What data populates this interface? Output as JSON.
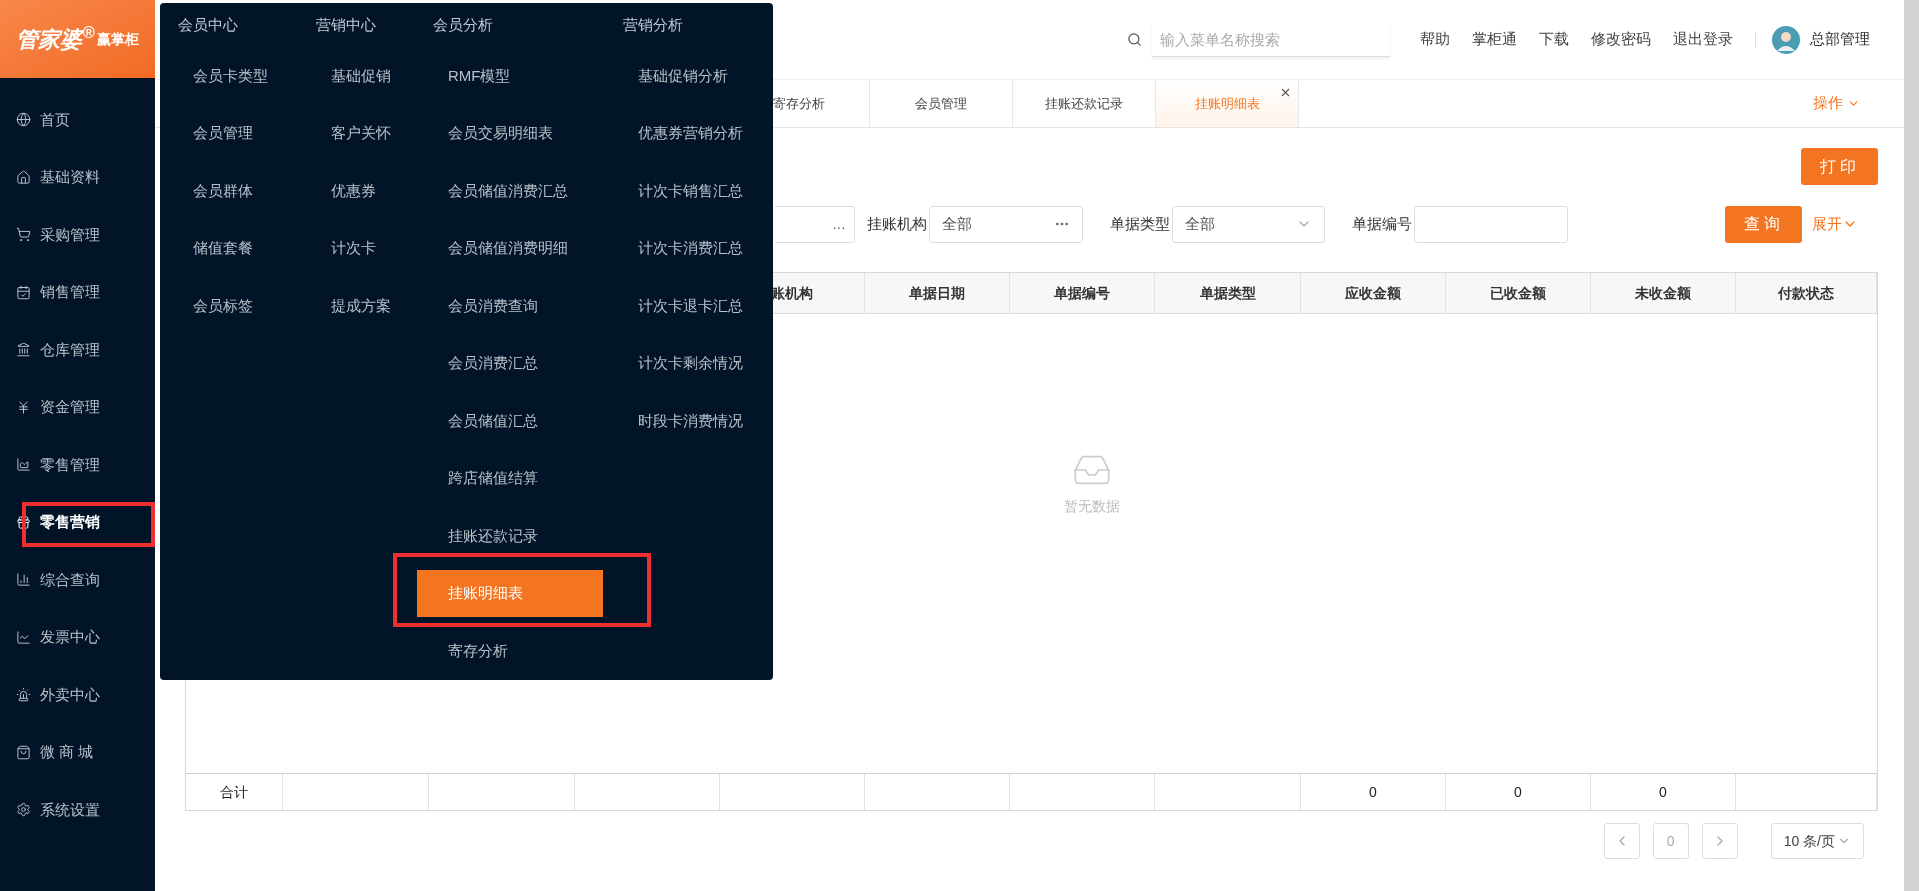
{
  "logo": {
    "title": "管家婆$^{®}$",
    "sub": "赢掌柜"
  },
  "sidebar": {
    "items": [
      {
        "label": "首页",
        "selected": false,
        "annotated": false
      },
      {
        "label": "基础资料",
        "selected": false,
        "annotated": false
      },
      {
        "label": "采购管理",
        "selected": false,
        "annotated": false
      },
      {
        "label": "销售管理",
        "selected": false,
        "annotated": false
      },
      {
        "label": "仓库管理",
        "selected": false,
        "annotated": false
      },
      {
        "label": "资金管理",
        "selected": false,
        "annotated": false
      },
      {
        "label": "零售管理",
        "selected": false,
        "annotated": false
      },
      {
        "label": "零售营销",
        "selected": true,
        "annotated": true
      },
      {
        "label": "综合查询",
        "selected": false,
        "annotated": false
      },
      {
        "label": "发票中心",
        "selected": false,
        "annotated": false
      },
      {
        "label": "外卖中心",
        "selected": false,
        "annotated": false
      },
      {
        "label": "微 商 城",
        "selected": false,
        "annotated": false
      },
      {
        "label": "系统设置",
        "selected": false,
        "annotated": false
      }
    ]
  },
  "menu": {
    "columns": [
      {
        "title": "会员中心",
        "items": [
          {
            "label": "会员卡类型",
            "selected": false,
            "annotated": false
          },
          {
            "label": "会员管理",
            "selected": false,
            "annotated": false
          },
          {
            "label": "会员群体",
            "selected": false,
            "annotated": false
          },
          {
            "label": "储值套餐",
            "selected": false,
            "annotated": false
          },
          {
            "label": "会员标签",
            "selected": false,
            "annotated": false
          }
        ]
      },
      {
        "title": "营销中心",
        "items": [
          {
            "label": "基础促销",
            "selected": false,
            "annotated": false
          },
          {
            "label": "客户关怀",
            "selected": false,
            "annotated": false
          },
          {
            "label": "优惠券",
            "selected": false,
            "annotated": false
          },
          {
            "label": "计次卡",
            "selected": false,
            "annotated": false
          },
          {
            "label": "提成方案",
            "selected": false,
            "annotated": false
          }
        ]
      },
      {
        "title": "会员分析",
        "items": [
          {
            "label": "RMF模型",
            "selected": false,
            "annotated": false
          },
          {
            "label": "会员交易明细表",
            "selected": false,
            "annotated": false
          },
          {
            "label": "会员储值消费汇总",
            "selected": false,
            "annotated": false
          },
          {
            "label": "会员储值消费明细",
            "selected": false,
            "annotated": false
          },
          {
            "label": "会员消费查询",
            "selected": false,
            "annotated": false
          },
          {
            "label": "会员消费汇总",
            "selected": false,
            "annotated": false
          },
          {
            "label": "会员储值汇总",
            "selected": false,
            "annotated": false
          },
          {
            "label": "跨店储值结算",
            "selected": false,
            "annotated": false
          },
          {
            "label": "挂账还款记录",
            "selected": false,
            "annotated": false
          },
          {
            "label": "挂账明细表",
            "selected": true,
            "annotated": true
          },
          {
            "label": "寄存分析",
            "selected": false,
            "annotated": false
          }
        ]
      },
      {
        "title": "营销分析",
        "items": [
          {
            "label": "基础促销分析",
            "selected": false,
            "annotated": false
          },
          {
            "label": "优惠券营销分析",
            "selected": false,
            "annotated": false
          },
          {
            "label": "计次卡销售汇总",
            "selected": false,
            "annotated": false
          },
          {
            "label": "计次卡消费汇总",
            "selected": false,
            "annotated": false
          },
          {
            "label": "计次卡退卡汇总",
            "selected": false,
            "annotated": false
          },
          {
            "label": "计次卡剩余情况",
            "selected": false,
            "annotated": false
          },
          {
            "label": "时段卡消费情况",
            "selected": false,
            "annotated": false
          }
        ]
      }
    ]
  },
  "header": {
    "search": {
      "placeholder": "输入菜单名称搜索"
    },
    "links": [
      "帮助",
      "掌柜通",
      "下载",
      "修改密码",
      "退出登录"
    ],
    "user": "总部管理"
  },
  "tabs": [
    {
      "label": "寄存分析",
      "selected": false,
      "closable": false
    },
    {
      "label": "会员管理",
      "selected": false,
      "closable": false
    },
    {
      "label": "挂账还款记录",
      "selected": false,
      "closable": false
    },
    {
      "label": "挂账明细表",
      "selected": true,
      "closable": true
    }
  ],
  "operations": "操作",
  "print_button": "打印",
  "filters": [
    {
      "kind": "partial",
      "value": "…"
    },
    {
      "kind": "picker",
      "label": "挂账机构",
      "value": "全部"
    },
    {
      "kind": "select",
      "label": "单据类型",
      "value": "全部"
    },
    {
      "kind": "text",
      "label": "单据编号"
    }
  ],
  "query_button": "查询",
  "expand_link": "展开",
  "table": {
    "columns": [
      "账机构",
      "单据日期",
      "单据编号",
      "单据类型",
      "应收金额",
      "已收金额",
      "未收金额",
      "付款状态"
    ],
    "empty_text": "暂无数据",
    "totals": {
      "label": "合计",
      "amounts": [
        "0",
        "0",
        "0"
      ]
    }
  },
  "pagination": {
    "page": "0",
    "page_size": "10 条/页"
  }
}
